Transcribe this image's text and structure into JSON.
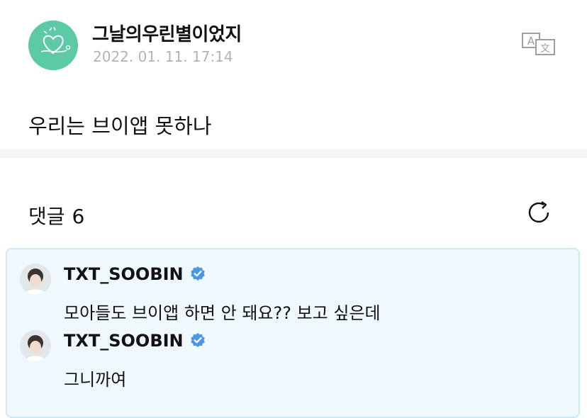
{
  "post": {
    "author": "그날의우린별이었지",
    "timestamp": "2022. 01. 11. 17:14",
    "body": "우리는 브이앱 못하나"
  },
  "comments_section": {
    "title": "댓글",
    "count": "6"
  },
  "comments": [
    {
      "author": "TXT_SOOBIN",
      "text": "모아들도 브이앱 하면 안 돼요?? 보고 싶은데"
    },
    {
      "author": "TXT_SOOBIN",
      "text": "그니까여"
    }
  ],
  "icons": {
    "translate": "translate-icon",
    "refresh": "refresh-icon",
    "verified": "verified-badge-icon"
  },
  "colors": {
    "avatar_bg": "#5cc9a7",
    "comment_bg": "#eff8fd",
    "comment_border": "#cfe8f5",
    "verified": "#4a97e8",
    "timestamp": "#b3b3b3"
  }
}
